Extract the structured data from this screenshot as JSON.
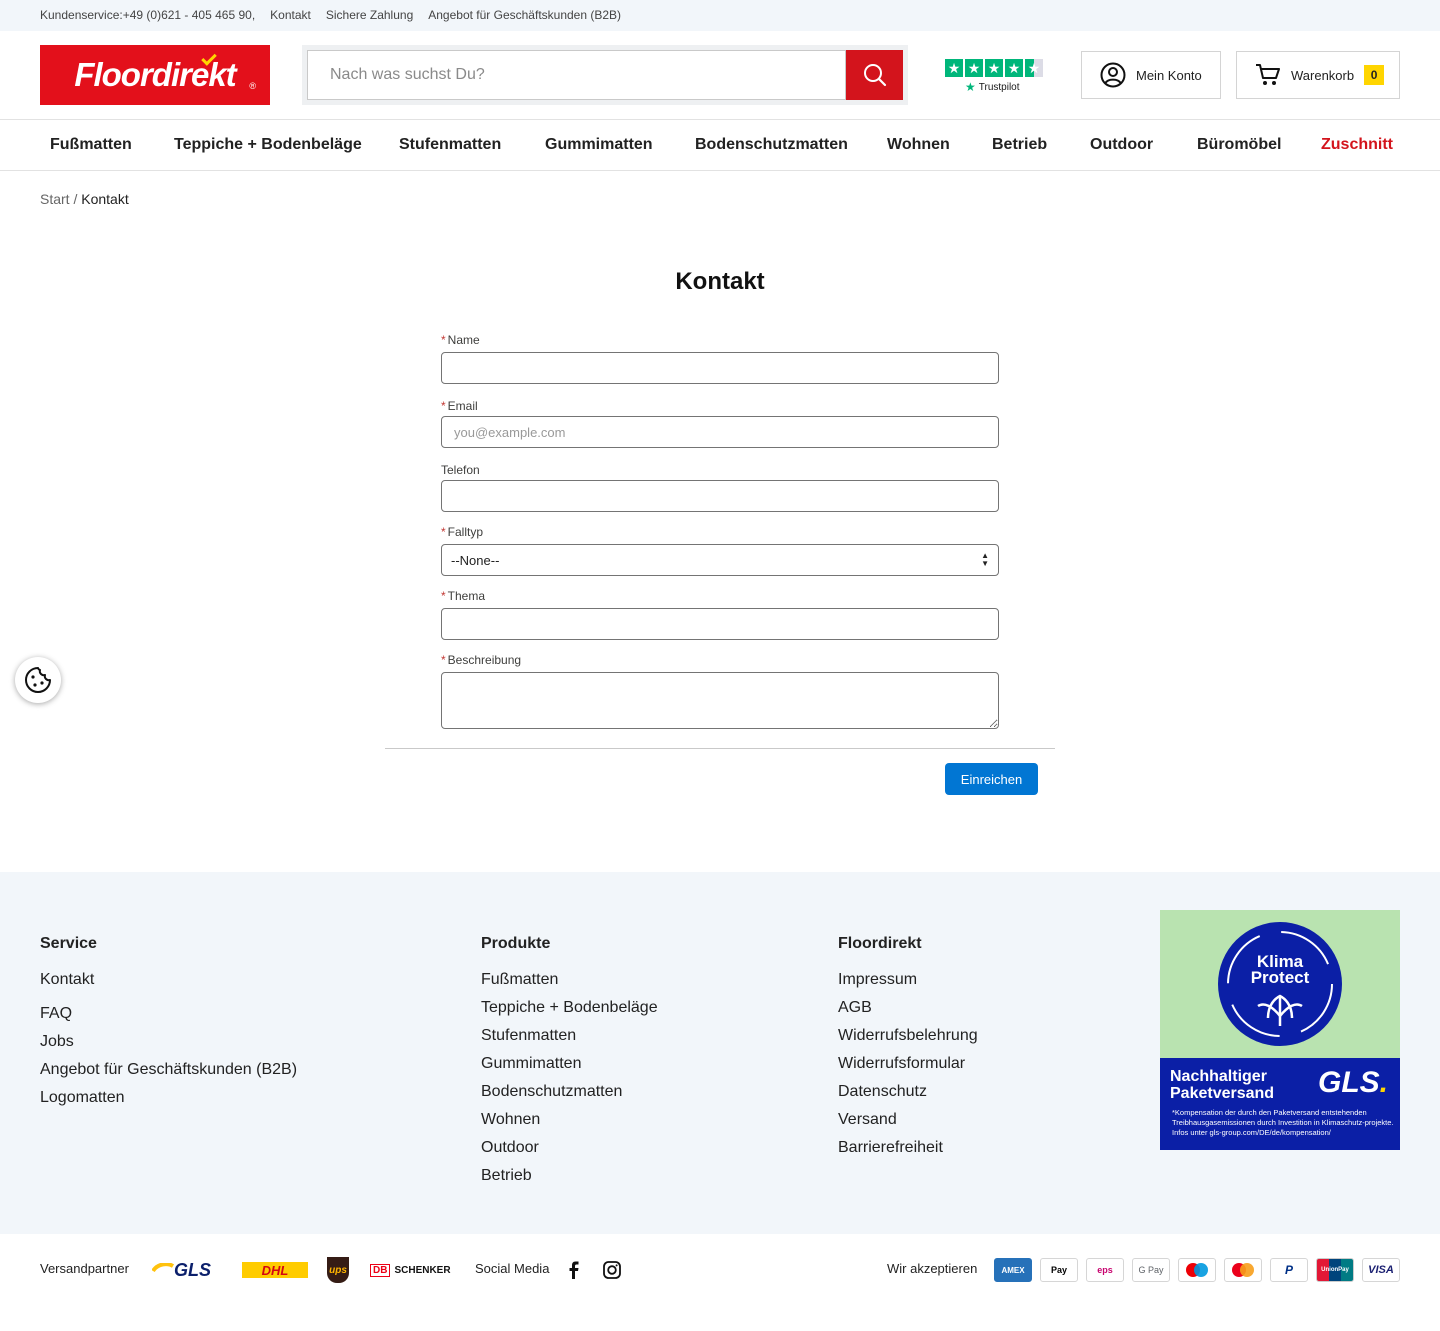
{
  "topbar": {
    "service": "Kundenservice:+49 (0)621 - 405 465 90,",
    "contact": "Kontakt",
    "secure_payment": "Sichere Zahlung",
    "b2b": "Angebot für Geschäftskunden (B2B)"
  },
  "header": {
    "logo_text": "Floordirekt",
    "logo_reg": "®",
    "search_placeholder": "Nach was suchst Du?",
    "trustpilot_label": "Trustpilot",
    "account_label": "Mein Konto",
    "cart_label": "Warenkorb",
    "cart_count": "0"
  },
  "nav": {
    "items": [
      "Fußmatten",
      "Teppiche + Bodenbeläge",
      "Stufenmatten",
      "Gummimatten",
      "Bodenschutzmatten",
      "Wohnen",
      "Betrieb",
      "Outdoor",
      "Büromöbel",
      "Zuschnitt"
    ]
  },
  "breadcrumb": {
    "home": "Start",
    "separator": "/",
    "current": "Kontakt"
  },
  "form": {
    "title": "Kontakt",
    "required_mark": "*",
    "name_label": "Name",
    "email_label": "Email",
    "email_placeholder": "you@example.com",
    "phone_label": "Telefon",
    "case_type_label": "Falltyp",
    "case_type_value": "--None--",
    "subject_label": "Thema",
    "description_label": "Beschreibung",
    "submit_label": "Einreichen"
  },
  "footer": {
    "service": {
      "title": "Service",
      "links": [
        "Kontakt",
        "FAQ",
        "Jobs",
        "Angebot für Geschäftskunden (B2B)",
        "Logomatten"
      ]
    },
    "products": {
      "title": "Produkte",
      "links": [
        "Fußmatten",
        "Teppiche + Bodenbeläge",
        "Stufenmatten",
        "Gummimatten",
        "Bodenschutzmatten",
        "Wohnen",
        "Outdoor",
        "Betrieb"
      ]
    },
    "company": {
      "title": "Floordirekt",
      "links": [
        "Impressum",
        "AGB",
        "Widerrufsbelehrung",
        "Widerrufsformular",
        "Datenschutz",
        "Versand",
        "Barrierefreiheit"
      ]
    },
    "gls_badge": {
      "circle_line1": "Klima",
      "circle_line2": "Protect",
      "headline1": "Nachhaltiger",
      "headline2": "Paketversand",
      "logo": "GLS",
      "note": "*Kompensation der durch den Paketversand entstehenden Treibhausgasemissionen durch Investition in Klimaschutz-projekte. Infos unter gls-group.com/DE/de/kompensation/"
    }
  },
  "bottom": {
    "shipping_label": "Versandpartner",
    "carriers": [
      "GLS",
      "DHL",
      "ups",
      "DB",
      "SCHENKER"
    ],
    "social_label": "Social Media",
    "payment_label": "Wir akzeptieren",
    "payments": [
      "AMEX",
      "Pay",
      "eps",
      "G Pay",
      "Maestro",
      "Mastercard",
      "P",
      "UnionPay",
      "VISA"
    ]
  },
  "colors": {
    "brand_red": "#e3101b",
    "submit_blue": "#0176d3",
    "footer_bg": "#f2f6fa",
    "trustpilot_green": "#00b67a",
    "cart_badge": "#ffd500"
  }
}
